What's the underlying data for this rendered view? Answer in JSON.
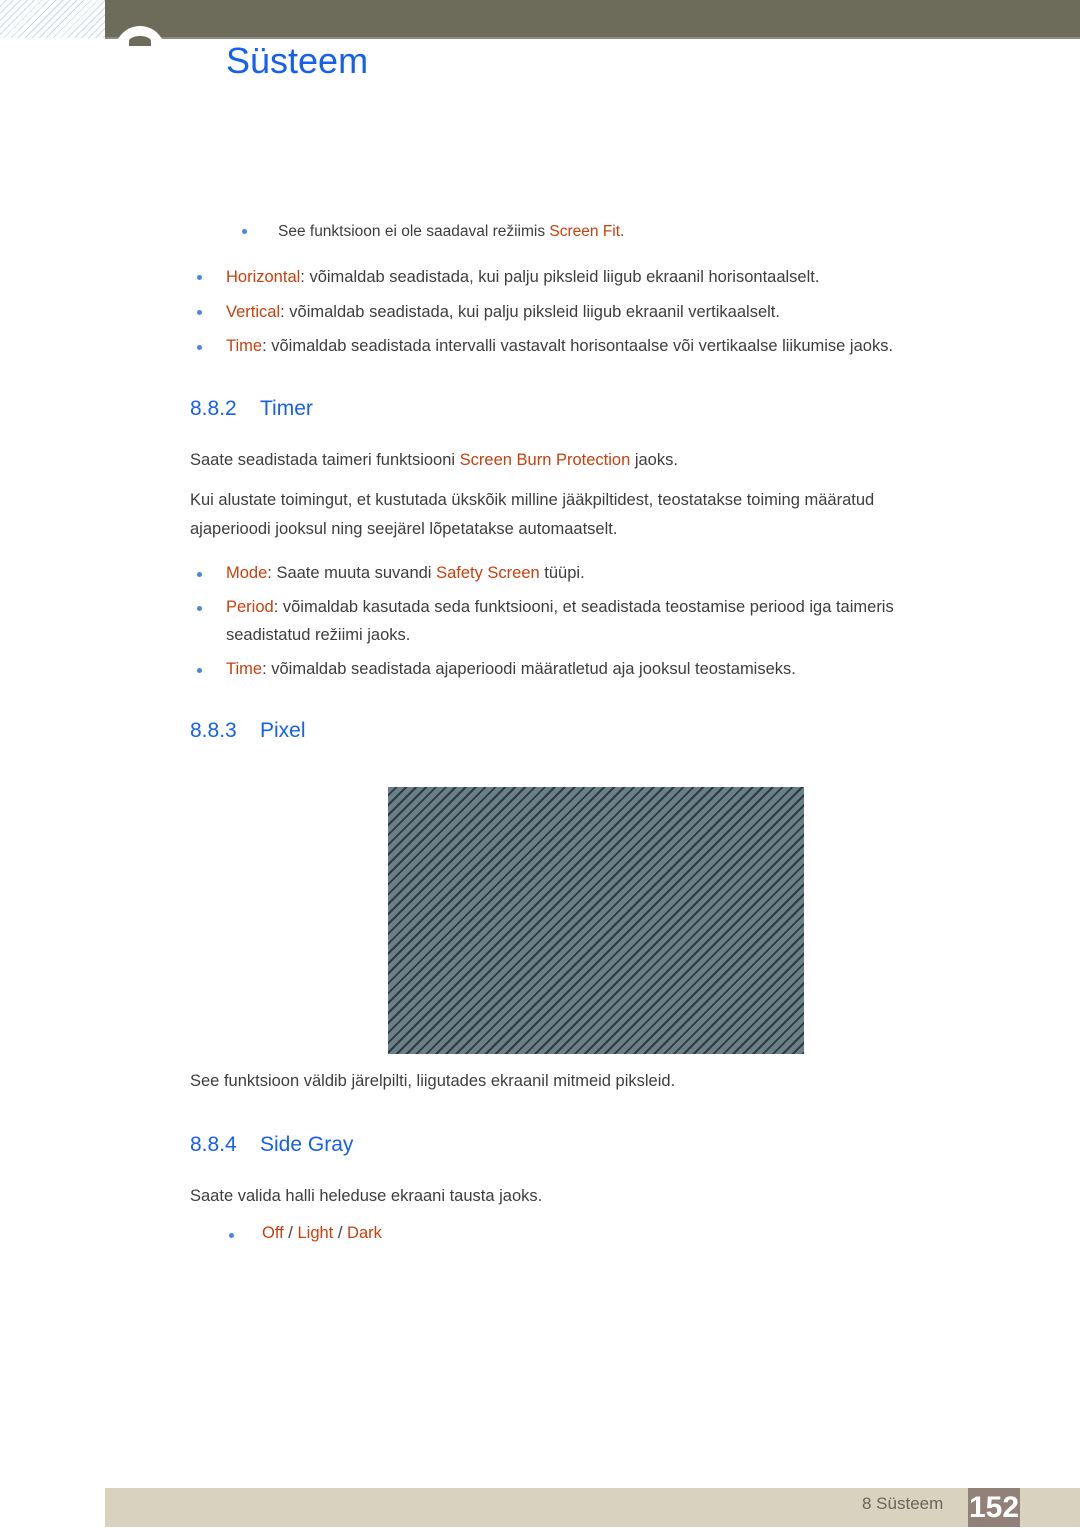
{
  "header": {
    "chapter_title": "Süsteem",
    "chapter_icon": "chapter-badge-icon"
  },
  "note": {
    "text": "See funktsioon ei ole saadaval režiimis ",
    "term": "Screen Fit",
    "suffix": "."
  },
  "intro_bullets": [
    {
      "term": "Horizontal",
      "text": ": võimaldab seadistada, kui palju piksleid liigub ekraanil horisontaalselt."
    },
    {
      "term": "Vertical",
      "text": ": võimaldab seadistada, kui palju piksleid liigub ekraanil vertikaalselt."
    },
    {
      "term": "Time",
      "text": ": võimaldab seadistada intervalli vastavalt horisontaalse või vertikaalse liikumise jaoks."
    }
  ],
  "sections": {
    "timer": {
      "number": "8.8.2",
      "title": "Timer",
      "para1_before": "Saate seadistada taimeri funktsiooni ",
      "para1_term": "Screen Burn Protection",
      "para1_after": " jaoks.",
      "para2_line1": "Kui alustate toimingut, et kustutada ükskõik milline jääkpiltidest, teostatakse toiming määratud",
      "para2_line2": "ajaperioodi jooksul ning seejärel lõpetatakse automaatselt.",
      "bullets": [
        {
          "term": "Mode",
          "text": ": Saate muuta suvandi ",
          "term2": "Safety Screen",
          "text2": " tüüpi."
        },
        {
          "term": "Period",
          "text": ": võimaldab kasutada seda funktsiooni, et seadistada teostamise periood iga taimeris",
          "line2": "seadistatud režiimi jaoks."
        },
        {
          "term": "Time",
          "text": ": võimaldab seadistada ajaperioodi määratletud aja jooksul teostamiseks."
        }
      ]
    },
    "pixel": {
      "number": "8.8.3",
      "title": "Pixel",
      "image_label": "pixel-shift-pattern-image",
      "caption": "See funktsioon väldib järelpilti, liigutades ekraanil mitmeid piksleid."
    },
    "side_gray": {
      "number": "8.8.4",
      "title": "Side Gray",
      "para": "Saate valida halli heleduse ekraani tausta jaoks.",
      "options": [
        "Off",
        "Light",
        "Dark"
      ],
      "separator": " / "
    }
  },
  "footer": {
    "chapter_label": "8 Süsteem",
    "page_number": "152"
  },
  "colors": {
    "heading_blue": "#1560f0",
    "term_orange": "#c8400e",
    "header_band": "#6d6c5a",
    "footer_band": "#d8d2bf",
    "page_badge": "#928178"
  }
}
